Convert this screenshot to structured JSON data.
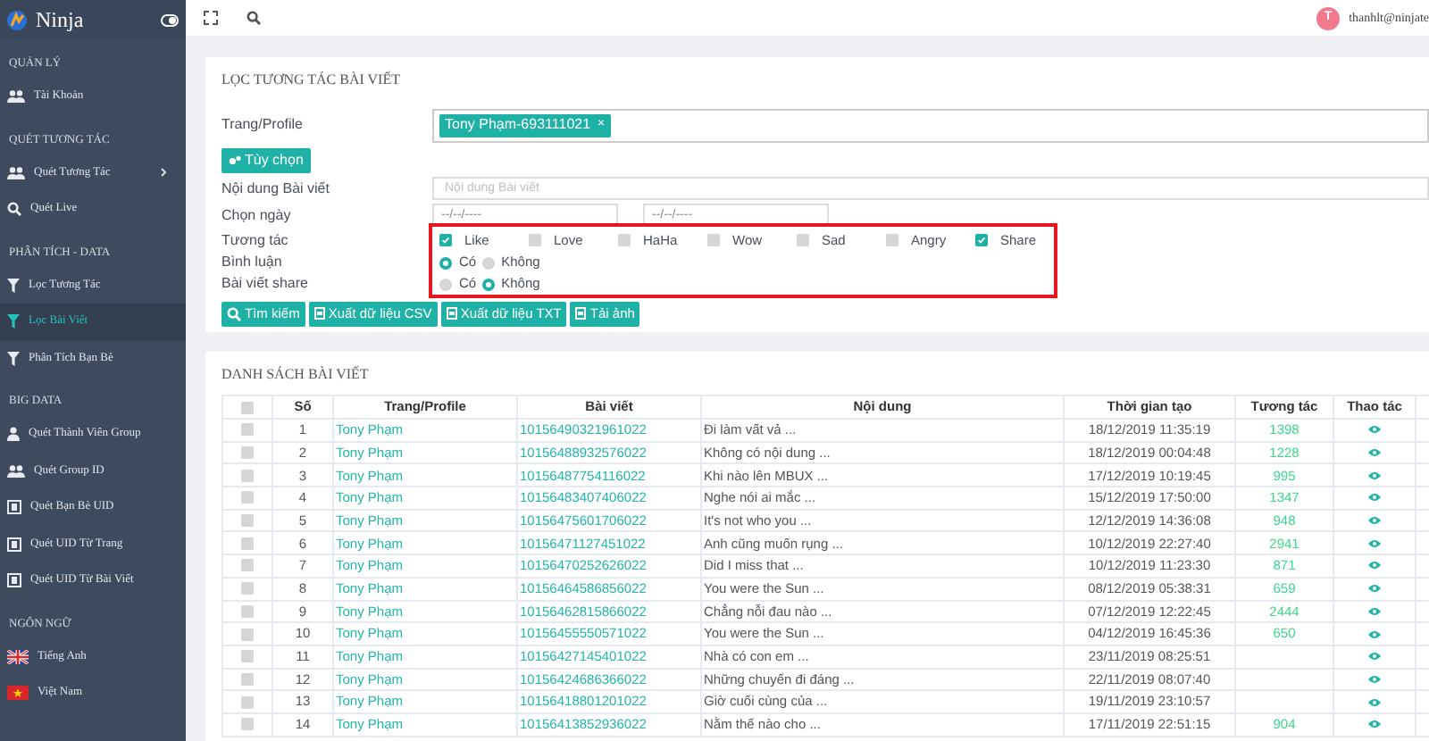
{
  "sidebar": {
    "brand": "Ninja",
    "sections": [
      {
        "heading": "QUẢN LÝ",
        "items": [
          {
            "label": "Tài Khoản",
            "selected": false
          }
        ]
      },
      {
        "heading": "QUÉT TƯƠNG TÁC",
        "items": [
          {
            "label": "Quét Tương Tác",
            "selected": false,
            "expanded": false
          },
          {
            "label": "Quét Live",
            "selected": false
          }
        ]
      },
      {
        "heading": "PHÂN TÍCH - DATA",
        "items": [
          {
            "label": "Lọc Tương Tác",
            "selected": false
          },
          {
            "label": "Lọc Bài Viết",
            "selected": true
          },
          {
            "label": "Phân Tích Bạn Bè",
            "selected": false
          }
        ]
      },
      {
        "heading": "BIG DATA",
        "items": [
          {
            "label": "Quét Thành Viên Group",
            "selected": false
          },
          {
            "label": "Quét Group ID",
            "selected": false
          },
          {
            "label": "Quét Bạn Bè UID",
            "selected": false
          },
          {
            "label": "Quét UID Từ Trang",
            "selected": false
          },
          {
            "label": "Quét UID Từ Bài Viết",
            "selected": false
          }
        ]
      },
      {
        "heading": "NGÔN NGỮ",
        "items": [
          {
            "label": "Tiếng Anh",
            "selected": false
          },
          {
            "label": "Việt Nam",
            "selected": false
          }
        ]
      }
    ]
  },
  "topbar": {
    "user": {
      "initial": "T",
      "email": "thanhlt@ninjate"
    }
  },
  "filter": {
    "title": "LỌC TƯƠNG TÁC BÀI VIẾT",
    "profile_label": "Trang/Profile",
    "profile_tags": [
      {
        "text": "Tony Phạm-693111021",
        "remove": "×"
      }
    ],
    "options_button": "Tùy chọn",
    "content_label": "Nội dung Bài viết",
    "content_placeholder": "Nội dung Bài viết",
    "date_label": "Chọn ngày",
    "date_fields": [
      {
        "placeholder": "--/--/----"
      },
      {
        "placeholder": "--/--/----"
      }
    ],
    "reactions_label": "Tương tác",
    "reactions": [
      {
        "label": "Like",
        "checked": true
      },
      {
        "label": "Love",
        "checked": false
      },
      {
        "label": "HaHa",
        "checked": false
      },
      {
        "label": "Wow",
        "checked": false
      },
      {
        "label": "Sad",
        "checked": false
      },
      {
        "label": "Angry",
        "checked": false
      },
      {
        "label": "Share",
        "checked": true
      }
    ],
    "comments": {
      "label": "Bình luận",
      "options": [
        {
          "label": "Có",
          "selected": true
        },
        {
          "label": "Không",
          "selected": false
        }
      ]
    },
    "shares": {
      "label": "Bài viết share",
      "options": [
        {
          "label": "Có",
          "selected": false
        },
        {
          "label": "Không",
          "selected": true
        }
      ]
    },
    "buttons": [
      "Tìm kiếm",
      "Xuất dữ liệu CSV",
      "Xuất dữ liệu TXT",
      "Tải ảnh"
    ]
  },
  "posts": {
    "title": "DANH SÁCH BÀI VIẾT",
    "select_all_checked": false,
    "columns": [
      "Số",
      "Trang/Profile",
      "Bài viết",
      "Nội dung",
      "Thời gian tạo",
      "Tương tác",
      "Thao tác"
    ],
    "rows": [
      {
        "checked": false,
        "number": "1",
        "profile": "Tony Phạm",
        "post_id": "10156490321961022",
        "content": "Đi làm vất vả ...",
        "created": "18/12/2019 11:35:19",
        "interactions": "1398"
      },
      {
        "checked": false,
        "number": "2",
        "profile": "Tony Phạm",
        "post_id": "10156488932576022",
        "content": "Không có nội dung ...",
        "created": "18/12/2019 00:04:48",
        "interactions": "1228"
      },
      {
        "checked": false,
        "number": "3",
        "profile": "Tony Phạm",
        "post_id": "10156487754116022",
        "content": "Khi nào lên MBUX ...",
        "created": "17/12/2019 10:19:45",
        "interactions": "995"
      },
      {
        "checked": false,
        "number": "4",
        "profile": "Tony Phạm",
        "post_id": "10156483407406022",
        "content": "Nghe nói ai mắc ...",
        "created": "15/12/2019 17:50:00",
        "interactions": "1347"
      },
      {
        "checked": false,
        "number": "5",
        "profile": "Tony Phạm",
        "post_id": "10156475601706022",
        "content": "It's not who you ...",
        "created": "12/12/2019 14:36:08",
        "interactions": "948"
      },
      {
        "checked": false,
        "number": "6",
        "profile": "Tony Phạm",
        "post_id": "10156471127451022",
        "content": "Anh cũng muốn rụng ...",
        "created": "10/12/2019 22:27:40",
        "interactions": "2941"
      },
      {
        "checked": false,
        "number": "7",
        "profile": "Tony Phạm",
        "post_id": "10156470252626022",
        "content": "Did I miss that ...",
        "created": "10/12/2019 11:23:30",
        "interactions": "871"
      },
      {
        "checked": false,
        "number": "8",
        "profile": "Tony Phạm",
        "post_id": "10156464586856022",
        "content": "You were the Sun ...",
        "created": "08/12/2019 05:38:31",
        "interactions": "659"
      },
      {
        "checked": false,
        "number": "9",
        "profile": "Tony Phạm",
        "post_id": "10156462815866022",
        "content": "Chẳng nỗi đau nào ...",
        "created": "07/12/2019 12:22:45",
        "interactions": "2444"
      },
      {
        "checked": false,
        "number": "10",
        "profile": "Tony Phạm",
        "post_id": "10156455550571022",
        "content": "You were the Sun ...",
        "created": "04/12/2019 16:45:36",
        "interactions": "650"
      },
      {
        "checked": false,
        "number": "11",
        "profile": "Tony Phạm",
        "post_id": "10156427145401022",
        "content": "Nhà có con em ...",
        "created": "23/11/2019 08:25:51"
      },
      {
        "checked": false,
        "number": "12",
        "profile": "Tony Phạm",
        "post_id": "10156424686366022",
        "content": "Những chuyến đi đáng ...",
        "created": "22/11/2019 08:07:40"
      },
      {
        "checked": false,
        "number": "13",
        "profile": "Tony Phạm",
        "post_id": "10156418801201022",
        "content": "Giờ cuối cùng của ...",
        "created": "19/11/2019 23:10:57"
      },
      {
        "checked": false,
        "number": "14",
        "profile": "Tony Phạm",
        "post_id": "10156413852936022",
        "content": "Nằm thế nào cho ...",
        "created": "17/11/2019 22:51:15",
        "interactions": "904"
      }
    ]
  }
}
